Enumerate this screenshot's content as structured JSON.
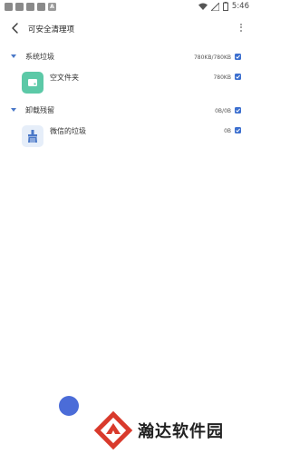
{
  "status_bar": {
    "time": "5:46",
    "indicator_label": "A",
    "icons": [
      "notification-icon",
      "notification-icon",
      "notification-icon",
      "notification-icon",
      "app-a-icon",
      "wifi-icon",
      "signal-icon",
      "battery-icon"
    ]
  },
  "header": {
    "title": "可安全清理项"
  },
  "groups": [
    {
      "name": "系统垃圾",
      "size": "780KB/780KB",
      "checked": true,
      "items": [
        {
          "name": "空文件夹",
          "size": "780KB",
          "checked": true,
          "icon": "folder-icon",
          "icon_color": "#5cc9a7"
        }
      ]
    },
    {
      "name": "卸载残留",
      "size": "0B/0B",
      "checked": true,
      "items": [
        {
          "name": "微信的垃圾",
          "size": "0B",
          "checked": true,
          "icon": "broom-icon",
          "icon_color": "#e6eef9"
        }
      ]
    }
  ],
  "colors": {
    "accent": "#3c6fcf",
    "caret": "#4a78c8"
  },
  "watermark": {
    "text": "瀚达软件园"
  }
}
